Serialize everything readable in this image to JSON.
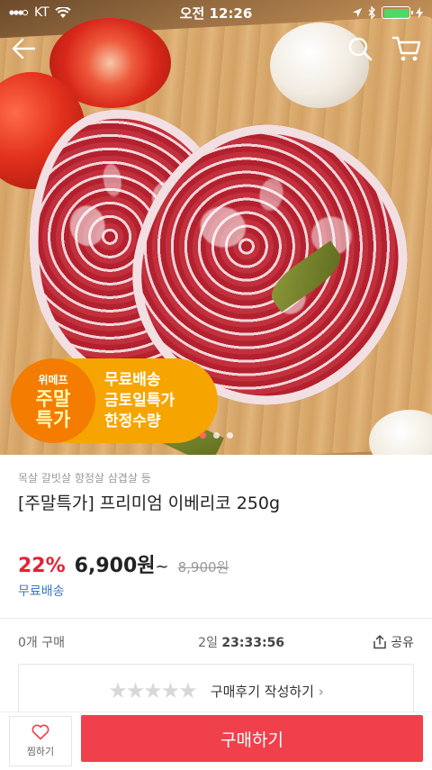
{
  "status_bar": {
    "carrier": "KT",
    "time": "오전 12:26",
    "battery_level": 1.0,
    "battery_color": "#4cd964",
    "icons": [
      "signal-icon",
      "wifi-icon",
      "location-icon",
      "bluetooth-icon",
      "battery-icon",
      "charging-icon"
    ]
  },
  "header": {
    "icons": [
      "back-arrow-icon",
      "search-icon",
      "cart-icon"
    ]
  },
  "promo_badge": {
    "brand": "위메프",
    "line1": "주말",
    "line2": "특가",
    "benefits": [
      "무료배송",
      "금토일특가",
      "한정수량"
    ]
  },
  "carousel": {
    "total": 3,
    "active_index": 0,
    "active_color": "#ff6a5a"
  },
  "product": {
    "category": "목살 갈빗살 항정살 삼겹살 등",
    "title": "[주말특가] 프리미엄 이베리코 250g",
    "discount": "22%",
    "price": "6,900원",
    "price_suffix": "~",
    "original_price": "8,900원",
    "shipping": "무료배송"
  },
  "meta": {
    "purchase_count": "0개 구매",
    "time_left_days": "2일",
    "time_left_clock": "23:33:56",
    "share_label": "공유"
  },
  "review": {
    "rating_stars": 0,
    "max_stars": 5,
    "cta_label": "구매후기 작성하기",
    "cta_arrow": "›"
  },
  "bottom_bar": {
    "wishlist_label": "찜하기",
    "buy_label": "구매하기",
    "buy_color": "#f0404b"
  },
  "colors": {
    "discount": "#e52233",
    "shipping": "#3a78c2",
    "badge_orange": "#f47c00",
    "badge_yellow": "#f6a500"
  }
}
